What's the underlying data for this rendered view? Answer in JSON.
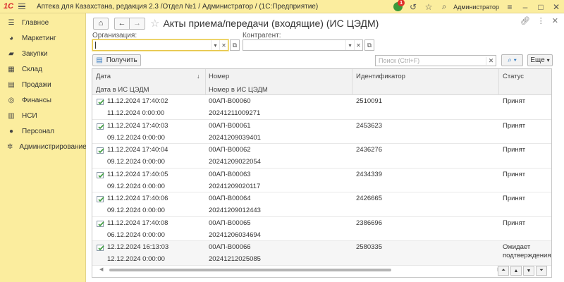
{
  "app": {
    "title": "Аптека для Казахстана, редакция 2.3 /Отдел №1 / Администратор /  (1С:Предприятие)",
    "logo_text": "1С",
    "user": "Администратор",
    "notifications_count": "1"
  },
  "sidebar": {
    "items": [
      {
        "label": "Главное",
        "icon": "menu-icon"
      },
      {
        "label": "Маркетинг",
        "icon": "pie-chart-icon"
      },
      {
        "label": "Закупки",
        "icon": "cart-icon"
      },
      {
        "label": "Склад",
        "icon": "warehouse-icon"
      },
      {
        "label": "Продажи",
        "icon": "sales-icon"
      },
      {
        "label": "Финансы",
        "icon": "coins-icon"
      },
      {
        "label": "НСИ",
        "icon": "reference-book-icon"
      },
      {
        "label": "Персонал",
        "icon": "person-icon"
      },
      {
        "label": "Администрирование",
        "icon": "gear-icon"
      }
    ]
  },
  "page": {
    "title": "Акты приема/передачи (входящие) (ИС ЦЭДМ)"
  },
  "filters": {
    "org_label": "Организация:",
    "org_value": "",
    "contractor_label": "Контрагент:",
    "contractor_value": ""
  },
  "toolbar": {
    "get_label": "Получить",
    "search_placeholder": "Поиск (Ctrl+F)",
    "more_label": "Еще"
  },
  "table": {
    "headers": {
      "date": "Дата",
      "date_sub": "Дата в ИС ЦЭДМ",
      "number": "Номер",
      "number_sub": "Номер в ИС ЦЭДМ",
      "id": "Идентификатор",
      "status": "Статус"
    },
    "rows": [
      {
        "date": "11.12.2024 17:40:02",
        "date2": "11.12.2024 0:00:00",
        "number": "00АП-В00060",
        "number2": "20241211009271",
        "id": "2510091",
        "status": "Принят",
        "status2": ""
      },
      {
        "date": "11.12.2024 17:40:03",
        "date2": "09.12.2024 0:00:00",
        "number": "00АП-В00061",
        "number2": "20241209039401",
        "id": "2453623",
        "status": "Принят",
        "status2": ""
      },
      {
        "date": "11.12.2024 17:40:04",
        "date2": "09.12.2024 0:00:00",
        "number": "00АП-В00062",
        "number2": "20241209022054",
        "id": "2436276",
        "status": "Принят",
        "status2": ""
      },
      {
        "date": "11.12.2024 17:40:05",
        "date2": "09.12.2024 0:00:00",
        "number": "00АП-В00063",
        "number2": "20241209020117",
        "id": "2434339",
        "status": "Принят",
        "status2": ""
      },
      {
        "date": "11.12.2024 17:40:06",
        "date2": "09.12.2024 0:00:00",
        "number": "00АП-В00064",
        "number2": "20241209012443",
        "id": "2426665",
        "status": "Принят",
        "status2": ""
      },
      {
        "date": "11.12.2024 17:40:08",
        "date2": "06.12.2024 0:00:00",
        "number": "00АП-В00065",
        "number2": "20241206034694",
        "id": "2386696",
        "status": "Принят",
        "status2": ""
      },
      {
        "date": "12.12.2024 16:13:03",
        "date2": "12.12.2024 0:00:00",
        "number": "00АП-В00066",
        "number2": "20241212025085",
        "id": "2580335",
        "status": "Ожидает",
        "status2": "подтверждения"
      }
    ]
  },
  "colors": {
    "panel": "#fbed9e",
    "accent_green": "#3b9b3b",
    "badge_red": "#e0302a"
  }
}
